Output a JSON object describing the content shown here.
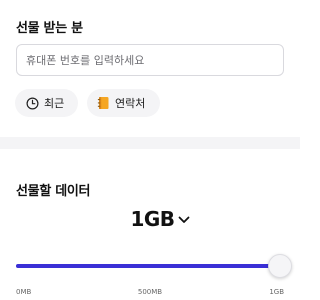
{
  "recipient": {
    "title": "선물 받는 분",
    "phone_placeholder": "휴대폰 번호를 입력하세요",
    "phone_value": "",
    "recent_label": "최근",
    "contacts_label": "연락처"
  },
  "gift_data": {
    "title": "선물할 데이터",
    "amount": "1GB",
    "slider": {
      "level_fraction": 1.0,
      "min_label": "0MB",
      "mid_label": "500MB",
      "max_label": "1GB"
    }
  },
  "colors": {
    "accent": "#3a2fd6",
    "track": "#e4e4ea",
    "chip_bg": "#f4f4f6",
    "contact_book": "#f5a623"
  },
  "icons": {
    "recent": "clock-icon",
    "contacts": "address-book-icon",
    "amount_dropdown": "chevron-down-icon"
  }
}
